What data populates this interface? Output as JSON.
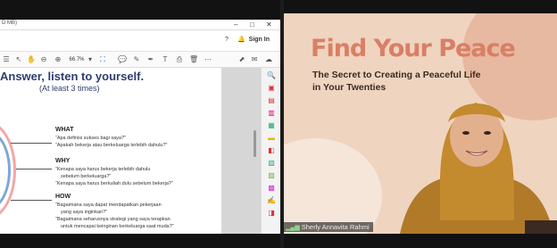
{
  "pdf_viewer": {
    "title_fragment": "D MB)",
    "window_controls": [
      "–",
      "□",
      "✕"
    ],
    "menubar": {
      "help": "?",
      "bell": "🔔",
      "signin": "Sign In"
    },
    "toolbar": {
      "zoom": "66.7%",
      "icons": [
        "save-icon",
        "hand-icon",
        "zoom-out-icon",
        "zoom-in-icon",
        "fit-icon",
        "comment-icon",
        "pen-icon",
        "highlight-icon",
        "stamp-icon",
        "trash-icon",
        "share-icon"
      ]
    },
    "slide": {
      "heading": "Answer, listen to yourself.",
      "subheading": "(At least 3 times)",
      "sections": [
        {
          "label": "WHAT",
          "lines": [
            "“Apa definisi sukses bagi saya?”",
            "“Apakah bekerja atau berkeluarga terlebih dahulu?”"
          ]
        },
        {
          "label": "WHY",
          "lines": [
            "“Kenapa saya harus bekerja terlebih dahulu",
            "sebelum berkeluarga?”",
            "“Kenapa saya harus berkuliah dulu sebelum bekerja?”"
          ]
        },
        {
          "label": "HOW",
          "lines": [
            "“Bagaimana saya dapat mendapatkan pekerjaan",
            "yang saya inginkan?”",
            "“Bagaimana seharusnya strategi yang saya terapkan",
            "untuk mencapai keinginan berkeluarga saat muda?”"
          ]
        }
      ]
    }
  },
  "video": {
    "title": "Find Your Peace",
    "subtitle_line1": "The Secret to Creating a Peaceful Life",
    "subtitle_line2": "in Your Twenties",
    "participant_name": "Sherly Annavita Rahmi"
  },
  "colors": {
    "slide_heading": "#2f3d6e",
    "video_title": "#d97f66",
    "video_bg": "#efd4c0",
    "hijab": "#c48a2e"
  }
}
